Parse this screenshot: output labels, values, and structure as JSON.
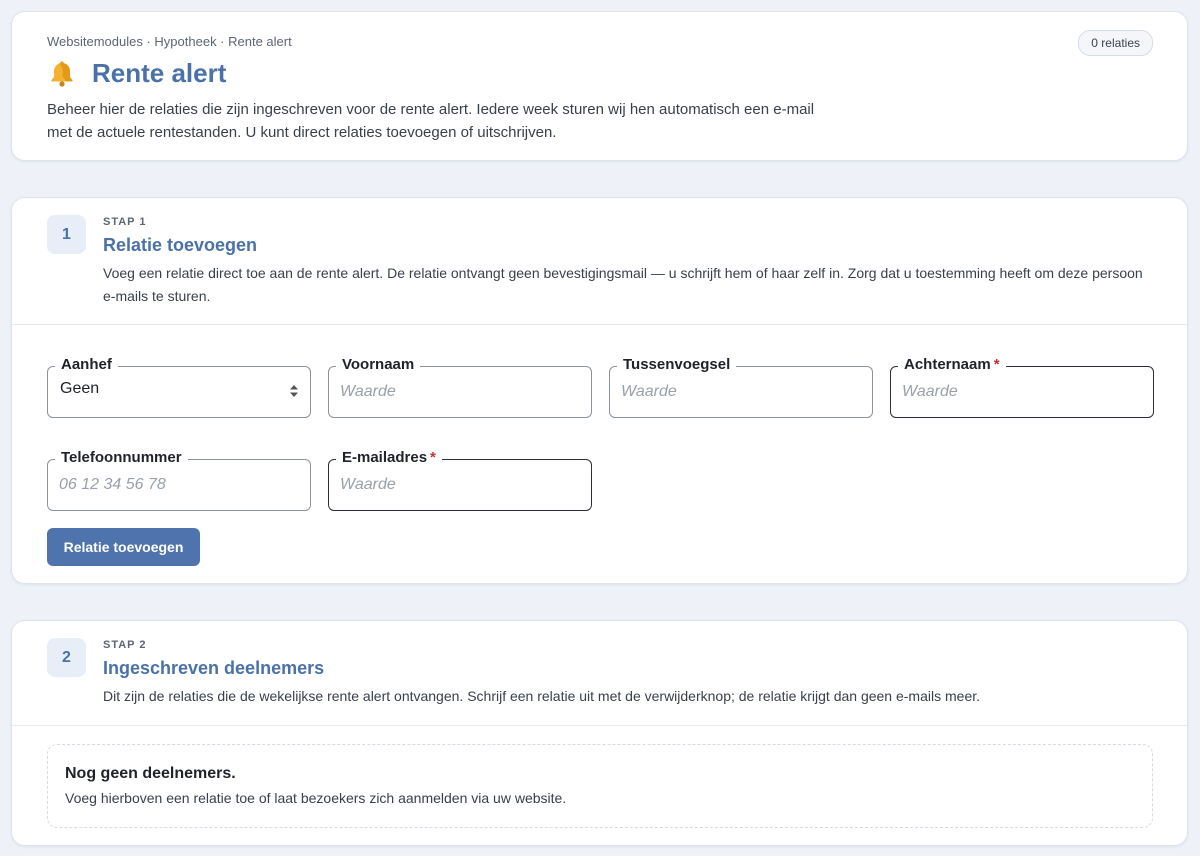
{
  "header": {
    "breadcrumb": "Websitemodules · Hypotheek · Rente alert",
    "title": "Rente alert",
    "title_icon": "bell-icon",
    "relations_badge": "0 relaties",
    "description": "Beheer hier de relaties die zijn ingeschreven voor de rente alert. Iedere week sturen wij hen automatisch een e-mail met de actuele rentestanden. U kunt direct relaties toevoegen of uitschrijven."
  },
  "step1": {
    "number": "1",
    "label": "STAP 1",
    "title": "Relatie toevoegen",
    "description": "Voeg een relatie direct toe aan de rente alert. De relatie ontvangt geen bevestigingsmail — u schrijft hem of haar zelf in. Zorg dat u toestemming heeft om deze persoon e-mails te sturen.",
    "fields": {
      "aanhef": {
        "label": "Aanhef",
        "value": "Geen"
      },
      "voornaam": {
        "label": "Voornaam",
        "placeholder": "Waarde"
      },
      "tussenvoegsel": {
        "label": "Tussenvoegsel",
        "placeholder": "Waarde"
      },
      "achternaam": {
        "label": "Achternaam",
        "placeholder": "Waarde",
        "required_marker": "*"
      },
      "telefoon": {
        "label": "Telefoonnummer",
        "placeholder": "06 12 34 56 78"
      },
      "email": {
        "label": "E-mailadres",
        "placeholder": "Waarde",
        "required_marker": "*"
      }
    },
    "submit_label": "Relatie toevoegen"
  },
  "step2": {
    "number": "2",
    "label": "STAP 2",
    "title": "Ingeschreven deelnemers",
    "description": "Dit zijn de relaties die de wekelijkse rente alert ontvangen. Schrijf een relatie uit met de verwijderknop; de relatie krijgt dan geen e-mails meer.",
    "empty_title": "Nog geen deelnemers.",
    "empty_description": "Voeg hierboven een relatie toe of laat bezoekers zich aanmelden via uw website."
  },
  "colors": {
    "accent": "#4a72a8",
    "button": "#4f74ad",
    "required": "#c53030",
    "background": "#eef2f8"
  }
}
